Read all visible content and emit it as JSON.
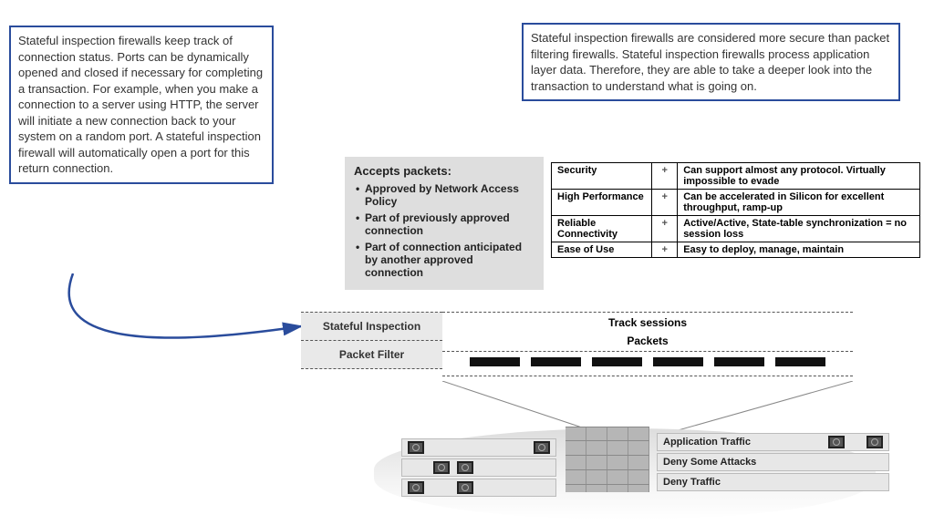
{
  "callouts": {
    "left": "Stateful inspection firewalls keep track of connection status. Ports can be dynamically opened and closed if necessary for completing a transaction. For example, when you make a connection to a server using HTTP, the server will initiate a new connection back to your system on a random port. A stateful inspection firewall will automatically open a port for this return connection.",
    "right": "Stateful inspection firewalls are considered more secure than packet filtering firewalls. Stateful inspection firewalls process application layer data. Therefore, they are able to take a deeper look into the transaction to understand what is going on."
  },
  "accepts": {
    "title": "Accepts packets:",
    "items": [
      "Approved by Network Access Policy",
      "Part of previously approved connection",
      "Part of connection anticipated by another approved connection"
    ]
  },
  "feature_table": [
    {
      "feature": "Security",
      "mark": "+",
      "desc": "Can support almost any protocol. Virtually impossible to evade"
    },
    {
      "feature": "High Performance",
      "mark": "+",
      "desc": "Can be accelerated in Silicon for excellent throughput, ramp-up"
    },
    {
      "feature": "Reliable Connectivity",
      "mark": "+",
      "desc": "Active/Active, State-table synchronization = no session loss"
    },
    {
      "feature": "Ease of Use",
      "mark": "+",
      "desc": "Easy to deploy, manage, maintain"
    }
  ],
  "layers": {
    "stateful": "Stateful Inspection",
    "packetfilter": "Packet Filter",
    "track": "Track sessions",
    "packets": "Packets"
  },
  "firewall_rules": {
    "r1": "Application Traffic",
    "r2": "Deny Some Attacks",
    "r3": "Deny Traffic"
  }
}
